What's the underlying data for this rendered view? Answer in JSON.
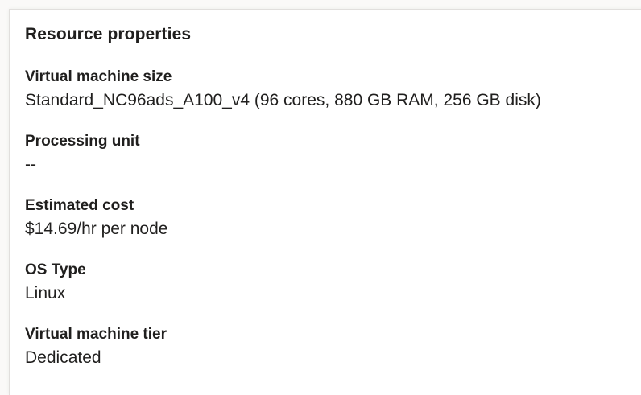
{
  "panel": {
    "title": "Resource properties"
  },
  "properties": [
    {
      "label": "Virtual machine size",
      "value": "Standard_NC96ads_A100_v4 (96 cores, 880 GB RAM, 256 GB disk)"
    },
    {
      "label": "Processing unit",
      "value": "--"
    },
    {
      "label": "Estimated cost",
      "value": "$14.69/hr per node"
    },
    {
      "label": "OS Type",
      "value": "Linux"
    },
    {
      "label": "Virtual machine tier",
      "value": "Dedicated"
    }
  ]
}
